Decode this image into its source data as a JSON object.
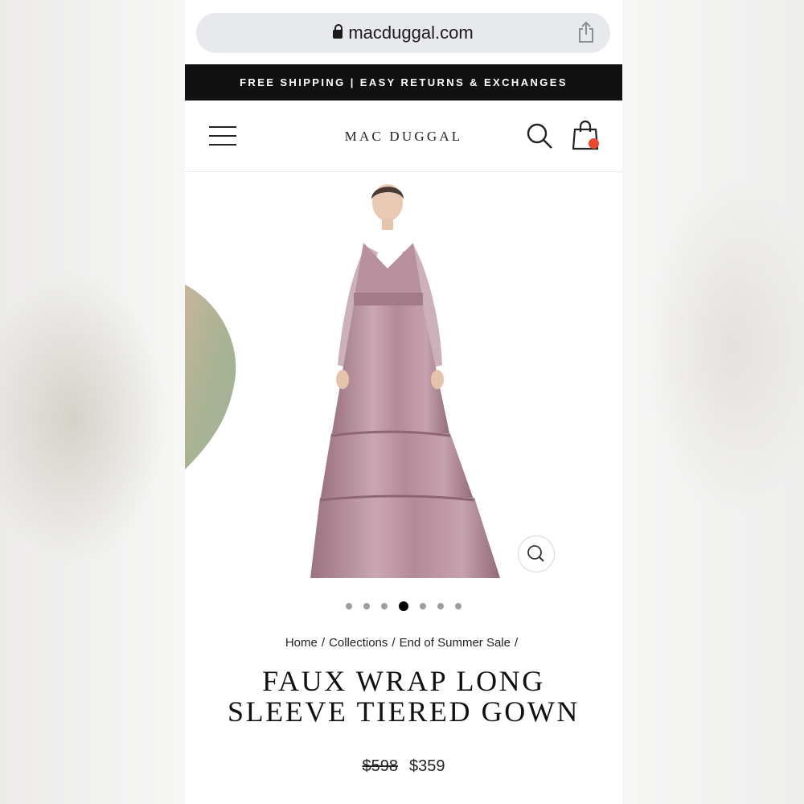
{
  "browser": {
    "url": "macduggal.com",
    "icons": [
      "lock-icon",
      "share-icon"
    ]
  },
  "promo": {
    "text": "FREE SHIPPING | EASY RETURNS & EXCHANGES"
  },
  "header": {
    "brand": "MAC DUGGAL",
    "icons": [
      "menu-icon",
      "search-icon",
      "shopping-bag-icon"
    ],
    "cart_badge_color": "#e8492f"
  },
  "gallery": {
    "slide_count": 7,
    "active_slide": 4,
    "gown_color": "#b58e9a",
    "zoom_icon": "magnifier-icon"
  },
  "breadcrumb": {
    "items": [
      "Home",
      "Collections",
      "End of Summer Sale"
    ],
    "separator": "/"
  },
  "product": {
    "title_line1": "FAUX WRAP LONG",
    "title_line2": "SLEEVE TIERED GOWN",
    "original_price": "$598",
    "sale_price": "$359"
  },
  "colors": {
    "promo_bg": "#111111",
    "urlbar_bg": "#e8e9ec"
  }
}
